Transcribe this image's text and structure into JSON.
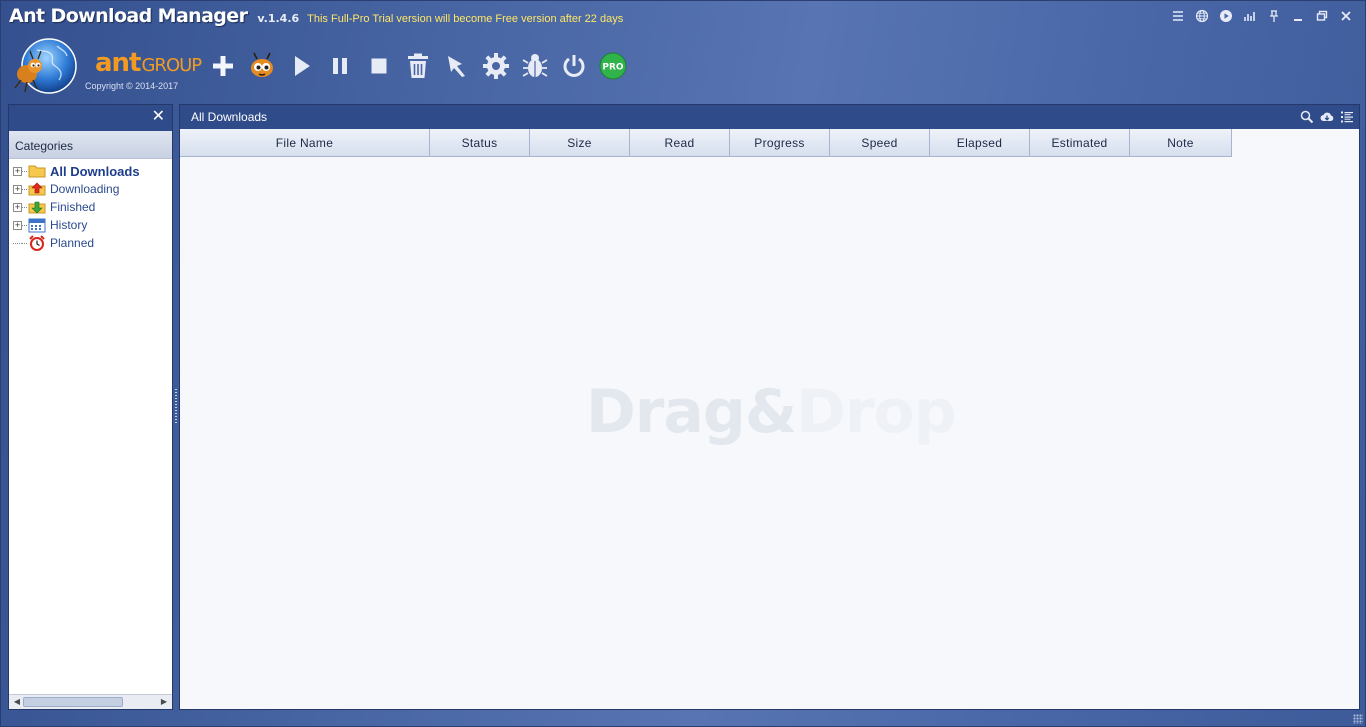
{
  "window": {
    "title": "Ant Download Manager",
    "version": "v.1.4.6",
    "trial_notice": "This Full-Pro Trial version will become Free version after 22 days"
  },
  "window_controls": [
    {
      "name": "menu-icon",
      "glyph": "≡"
    },
    {
      "name": "globe-icon",
      "glyph": "globe"
    },
    {
      "name": "play-circle-icon",
      "glyph": "play"
    },
    {
      "name": "chart-icon",
      "glyph": "chart"
    },
    {
      "name": "pin-icon",
      "glyph": "pin"
    },
    {
      "name": "minimize-icon",
      "glyph": "min"
    },
    {
      "name": "restore-icon",
      "glyph": "restore"
    },
    {
      "name": "close-icon",
      "glyph": "close"
    }
  ],
  "brand": {
    "ant": "ant",
    "group": "GROUP",
    "copyright": "Copyright © 2014-2017"
  },
  "toolbar": [
    {
      "name": "add-url-button",
      "icon": "plus-icon"
    },
    {
      "name": "ant-mascot-button",
      "icon": "ant-icon"
    },
    {
      "name": "start-button",
      "icon": "play-icon"
    },
    {
      "name": "pause-button",
      "icon": "pause-icon"
    },
    {
      "name": "stop-button",
      "icon": "stop-icon"
    },
    {
      "name": "delete-button",
      "icon": "trash-icon"
    },
    {
      "name": "rocket-button",
      "icon": "rocket-icon"
    },
    {
      "name": "settings-button",
      "icon": "gear-icon"
    },
    {
      "name": "bug-report-button",
      "icon": "bug-icon"
    },
    {
      "name": "shutdown-button",
      "icon": "power-icon"
    },
    {
      "name": "pro-button",
      "icon": "pro-badge-icon",
      "label": "PRO"
    }
  ],
  "sidebar": {
    "close_glyph": "✕",
    "categories_label": "Categories",
    "items": [
      {
        "label": "All Downloads",
        "icon": "folder-icon",
        "expandable": true,
        "active": true
      },
      {
        "label": "Downloading",
        "icon": "download-arrow-icon",
        "expandable": true,
        "active": false
      },
      {
        "label": "Finished",
        "icon": "finished-arrow-icon",
        "expandable": true,
        "active": false
      },
      {
        "label": "History",
        "icon": "calendar-icon",
        "expandable": true,
        "active": false
      },
      {
        "label": "Planned",
        "icon": "alarm-clock-icon",
        "expandable": false,
        "active": false
      }
    ]
  },
  "main": {
    "title": "All Downloads",
    "columns": [
      "File Name",
      "Status",
      "Size",
      "Read",
      "Progress",
      "Speed",
      "Elapsed",
      "Estimated",
      "Note"
    ],
    "watermark_left": "Drag&",
    "watermark_right": "Drop"
  },
  "colors": {
    "accent_orange": "#f29a22",
    "trial_yellow": "#ffe766",
    "header_blue": "#2f4b8a",
    "link_blue": "#2b4a8e",
    "pro_green": "#2fb34a"
  }
}
